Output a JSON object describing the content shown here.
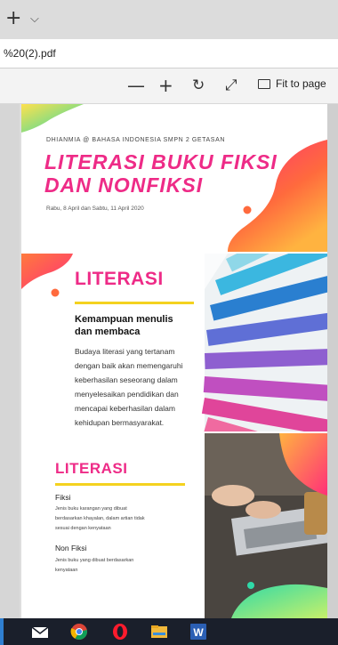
{
  "browser": {
    "new_tab": "+",
    "tab_menu": "⌵",
    "address": "%20(2).pdf"
  },
  "pdf_toolbar": {
    "zoom_out": "—",
    "zoom_in": "+",
    "rotate": "↻",
    "fullscreen": "⤢",
    "fit_label": "Fit to page"
  },
  "slide1": {
    "author": "DHIANMIA @ BAHASA INDONESIA SMPN 2 GETASAN",
    "title_line1": "LITERASI BUKU FIKSI",
    "title_line2": "DAN NONFIKSI",
    "date": "Rabu, 8 April dan Sabtu, 11 April 2020"
  },
  "slide2": {
    "title": "LITERASI",
    "subtitle_line1": "Kemampuan menulis",
    "subtitle_line2": "dan membaca",
    "body_lines": [
      "Budaya literasi yang tertanam",
      "dengan baik akan memengaruhi",
      "keberhasilan seseorang dalam",
      "menyelesaikan pendidikan dan",
      "mencapai keberhasilan dalam",
      "kehidupan bermasyarakat."
    ]
  },
  "slide3": {
    "title": "LITERASI",
    "fiksi_heading": "Fiksi",
    "fiksi_lines": [
      "Jenis buku karangan yang dibuat",
      "berdasarkan khayalan, dalam artian tidak",
      "sesuai dengan kenyataan"
    ],
    "nonfiksi_heading": "Non Fiksi",
    "nonfiksi_lines": [
      "Jenis buku yang dibuat berdasarkan",
      "kenyataan"
    ]
  },
  "taskbar": {
    "icons": [
      "mail-icon",
      "chrome-icon",
      "opera-icon",
      "file-explorer-icon",
      "word-icon"
    ],
    "word_letter": "W"
  },
  "colors": {
    "accent_pink": "#ee2b87",
    "accent_yellow": "#f4d21f",
    "taskbar": "#1a1f2b"
  }
}
